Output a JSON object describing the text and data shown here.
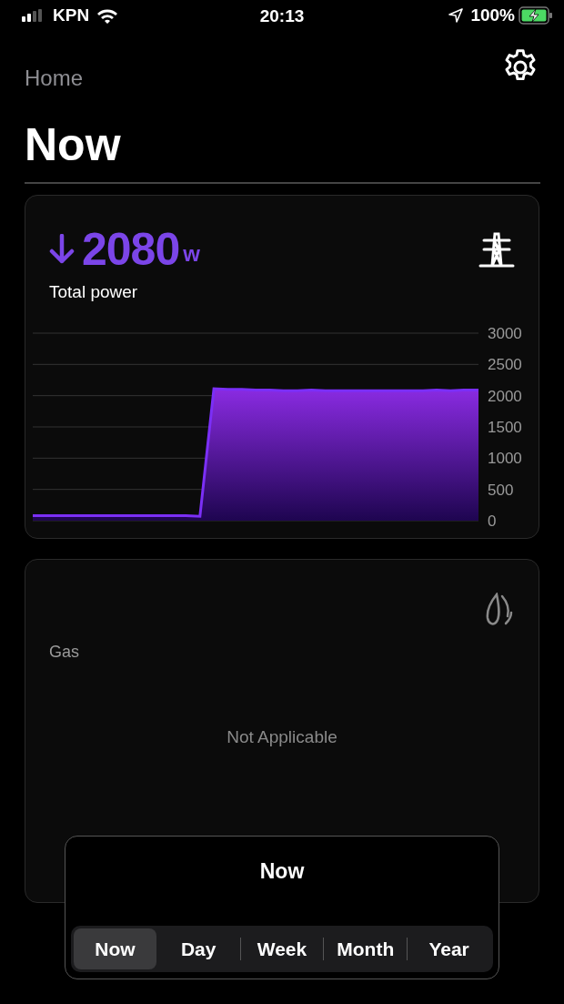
{
  "status_bar": {
    "carrier": "KPN",
    "time": "20:13",
    "battery": "100%"
  },
  "header": {
    "back": "Home",
    "title": "Now"
  },
  "power_card": {
    "importing": true,
    "value": "2080",
    "unit": "w",
    "label": "Total power",
    "chart_data": {
      "type": "area",
      "grid": true,
      "ylim": [
        0,
        3000
      ],
      "yticks": [
        0,
        500,
        1000,
        1500,
        2000,
        2500,
        3000
      ],
      "series": [
        {
          "color": "#8a2be2",
          "values": [
            80,
            80,
            80,
            80,
            80,
            80,
            80,
            80,
            80,
            80,
            80,
            80,
            70,
            2110,
            2100,
            2100,
            2090,
            2090,
            2080,
            2080,
            2090,
            2080,
            2080,
            2080,
            2080,
            2080,
            2080,
            2080,
            2080,
            2090,
            2080,
            2090,
            2090
          ]
        }
      ]
    }
  },
  "gas_card": {
    "label": "Gas",
    "message": "Not Applicable"
  },
  "period_picker": {
    "title": "Now",
    "options": [
      {
        "label": "Now",
        "selected": true
      },
      {
        "label": "Day",
        "selected": false
      },
      {
        "label": "Week",
        "selected": false
      },
      {
        "label": "Month",
        "selected": false
      },
      {
        "label": "Year",
        "selected": false
      }
    ]
  }
}
